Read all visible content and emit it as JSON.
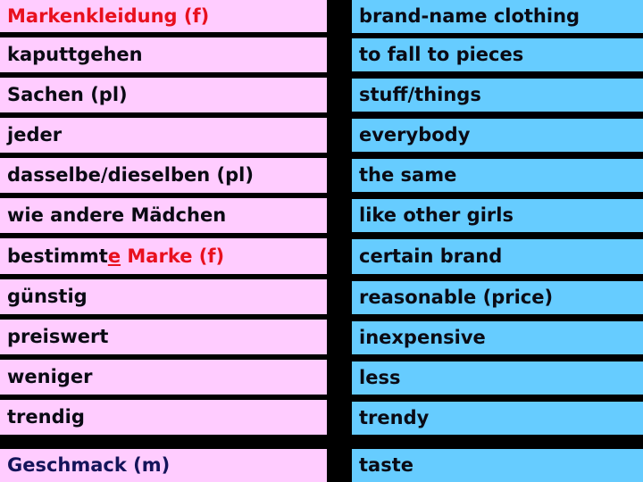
{
  "colors": {
    "german_bg": "#FFCCFF",
    "english_bg": "#66CCFF",
    "separator": "#000000",
    "text": "#0A0A14",
    "feminine_highlight": "#E8101E",
    "masculine_highlight": "#14145A"
  },
  "vocabulary": [
    {
      "german": "Markenkleidung (f)",
      "english": "brand-name clothing",
      "gender": "f"
    },
    {
      "german": "kaputtgehen",
      "english": "to fall to pieces"
    },
    {
      "german": "Sachen (pl)",
      "english": "stuff/things"
    },
    {
      "german": "jeder",
      "english": "everybody"
    },
    {
      "german": "dasselbe/dieselben (pl)",
      "english": "the same"
    },
    {
      "german": "wie andere Mädchen",
      "english": "like other girls"
    },
    {
      "german_parts": [
        "bestimmt",
        "e",
        " Marke (f)"
      ],
      "german": "bestimmte Marke (f)",
      "english": "certain brand",
      "gender": "f"
    },
    {
      "german": "günstig",
      "english": "reasonable (price)"
    },
    {
      "german": "preiswert",
      "english": "inexpensive"
    },
    {
      "german": "weniger",
      "english": "less"
    },
    {
      "german": "trendig",
      "english": "trendy"
    },
    {
      "german": "Geschmack (m)",
      "english": "taste",
      "gender": "m"
    }
  ]
}
